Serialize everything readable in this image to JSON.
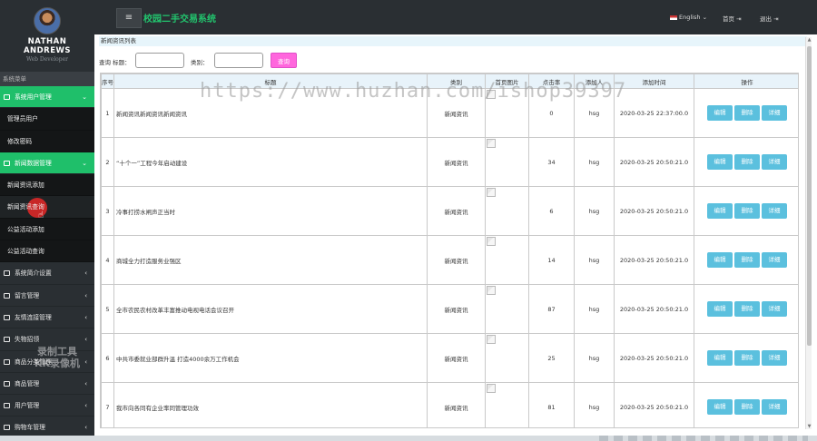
{
  "sidebar": {
    "profile_name_line1": "NATHAN",
    "profile_name_line2": "ANDREWS",
    "profile_subtitle": "Web Developer",
    "menu_caption": "系统菜单",
    "groups": [
      {
        "label": "系统用户管理",
        "open": true,
        "caret": "⌄",
        "items": [
          {
            "label": "管理员用户"
          },
          {
            "label": "修改密码"
          }
        ]
      },
      {
        "label": "新闻数据管理",
        "open": true,
        "caret": "⌄",
        "items": [
          {
            "label": "新闻资讯添加"
          },
          {
            "label": "新闻资讯查询",
            "active": true
          },
          {
            "label": "公益活动添加"
          },
          {
            "label": "公益活动查询"
          }
        ]
      },
      {
        "label": "系统简介设置",
        "caret": "‹"
      },
      {
        "label": "留言管理",
        "caret": "‹"
      },
      {
        "label": "友情连接管理",
        "caret": "‹"
      },
      {
        "label": "失物招领",
        "caret": "‹"
      },
      {
        "label": "商品分类管理",
        "caret": "‹"
      },
      {
        "label": "商品管理",
        "caret": "‹"
      },
      {
        "label": "用户管理",
        "caret": "‹"
      },
      {
        "label": "购物车管理",
        "caret": "‹"
      }
    ],
    "recorder_line1": "录制工具",
    "recorder_line2": "KK录像机"
  },
  "header": {
    "toggle_icon": "≡",
    "title": "校园二手交易系统",
    "language": "English",
    "language_caret": "⌄",
    "home_label": "首页",
    "logout_label": "退出",
    "link_icon": "⇥"
  },
  "breadcrumb": "新闻资讯列表",
  "search": {
    "title_label": "查询 标题：",
    "title_value": "",
    "category_label": "类别：",
    "category_value": "",
    "button_label": "查询"
  },
  "table": {
    "columns": [
      "序号",
      "标题",
      "类别",
      "首页图片",
      "点击率",
      "添加人",
      "添加时间",
      "操作"
    ],
    "actions": {
      "edit": "编辑",
      "delete": "删除",
      "detail": "详细"
    },
    "rows": [
      {
        "no": "1",
        "title": "新闻资讯新闻资讯新闻资讯",
        "category": "新闻资讯",
        "clicks": "0",
        "author": "hsg",
        "time": "2020-03-25 22:37:00.0"
      },
      {
        "no": "2",
        "title": "“十个一”工程今年启动建设",
        "category": "新闻资讯",
        "clicks": "34",
        "author": "hsg",
        "time": "2020-03-25 20:50:21.0"
      },
      {
        "no": "3",
        "title": "冷事打捞水闸声正当时",
        "category": "新闻资讯",
        "clicks": "6",
        "author": "hsg",
        "time": "2020-03-25 20:50:21.0"
      },
      {
        "no": "4",
        "title": "商城全力打造服务业强区",
        "category": "新闻资讯",
        "clicks": "14",
        "author": "hsg",
        "time": "2020-03-25 20:50:21.0"
      },
      {
        "no": "5",
        "title": "全市农民农村改革丰富推动电视电话会议召开",
        "category": "新闻资讯",
        "clicks": "87",
        "author": "hsg",
        "time": "2020-03-25 20:50:21.0"
      },
      {
        "no": "6",
        "title": "中共市委就业部群升温 打造4000余万工作机会",
        "category": "新闻资讯",
        "clicks": "25",
        "author": "hsg",
        "time": "2020-03-25 20:50:21.0"
      },
      {
        "no": "7",
        "title": "我市向各同有企业率同管理功效",
        "category": "新闻资讯",
        "clicks": "81",
        "author": "hsg",
        "time": "2020-03-25 20:50:21.0"
      }
    ]
  },
  "watermark": "https://www.huzhan.com/ishop39397",
  "colors": {
    "accent_green": "#1fbf6a",
    "sidebar_bg": "#2a2f33",
    "action_blue": "#5bc0de",
    "search_pink": "#ff66dd"
  }
}
